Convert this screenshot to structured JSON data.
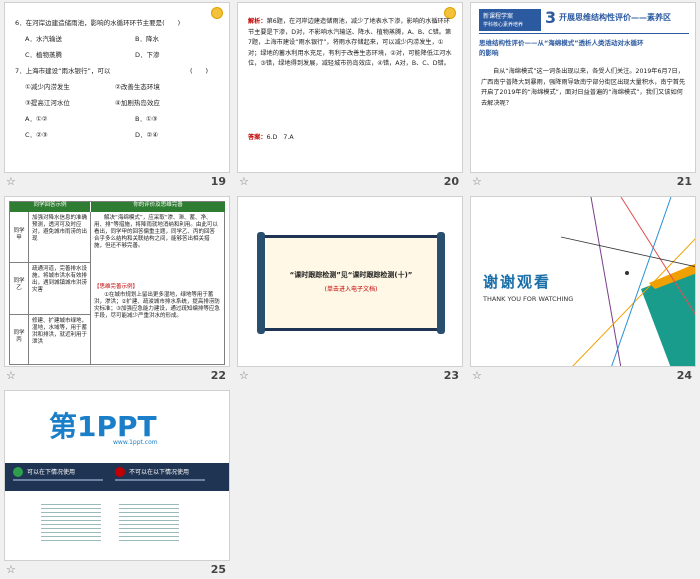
{
  "slides": [
    {
      "number": "19",
      "lines": [
        "6．在河岸边建造储雨池，影响的水循环环节主要是(　　)",
        "A．水汽输送",
        "B．降水",
        "C．植物蒸腾",
        "D．下渗",
        "7．上海市建设“雨水银行”，可以",
        "(　　)",
        "①减少内涝发生",
        "②改善生态环境",
        "③提高江河水位",
        "④加剧热岛效应",
        "A．①②",
        "B．①③",
        "C．②③",
        "D．②④"
      ]
    },
    {
      "number": "20",
      "label": "解析：",
      "text": "第6题，在河岸边建造储雨池，减少了地表水下渗，影响的水循环环节主要是下渗，D对，不影响水汽输送、降水、植物蒸腾，A、B、C错。第7题，上海市建设“雨水银行”，将雨水存储起来，可以减少内涝发生，①对；绿地的蓄水利用水充足，有利于改善生态环境，②对，可能降低江河水位，③错，绿地得到发展，减轻城市热岛效应，④错，A对，B、C、D错。",
      "answer_label": "答案：",
      "answer": "6.D　7.A"
    },
    {
      "number": "21",
      "header_small": "新课程学案",
      "header_sub": "学科核心素养培养",
      "header_num": "3",
      "header_title": "开展思维结构性评价——素养区",
      "subtitle_line1": "思维结构性评价——从“海绵模式”透析人类活动对水循环",
      "subtitle_line2": "的影响",
      "body": "自从“海绵模式”这一词条出现以来，各受人们关注。2019年6月7日，广西南宁普降大到暴雨，强降雨导致南宁部分街区出现大量积水，南宁首先开启了2019年的“海绵模式”，面对日益普遍的“海绵模式”，我们又该如何去解决呢？"
    },
    {
      "number": "22",
      "table_header": [
        "同学回答示例",
        "你的评价及思维完善"
      ],
      "rows": [
        {
          "name": "同学甲",
          "answer": "加强对降水信息的准确预测，透河可及时应对，避免城市雨涝的出现"
        },
        {
          "name": "同学乙",
          "answer": "疏通河道，完善排水设施，将城市洪水有效排出，遇到城镇城市洪涝灾害"
        },
        {
          "name": "同学丙",
          "answer": "修建、扩建城市绿地，湿地，水域等，用于蓄洪和排洪，就近利用于泄洪"
        }
      ],
      "eval1": "解决“海绵模式”，应采取“渗、滞、蓄、净、用、排”等措施，将降雨就地消纳和利用。由此可以看出，同学甲的回答偏重主题，同学乙、丙的回答合乎多么结构和关联结构之间，能够答出相关措施，但还不够完善。",
      "complete_label": "【思维完善示例】",
      "eval2": "①在城市规划上留出更多湿地，绿地等用于蓄洪，渗洪；②扩建、疏浚城市排水系统，提高排涝防灾标准；③加强应急能力建设，通过疏知编排等应急手段，尽可能减少严重洪水的形成。"
    },
    {
      "number": "23",
      "scroll_main": "“课时跟踪检测”见“课时跟踪检测(十)”",
      "scroll_sub": "(单击进入电子文档)"
    },
    {
      "number": "24",
      "thanks_title": "谢谢观看",
      "thanks_sub": "THANK YOU FOR WATCHING"
    },
    {
      "number": "25",
      "logo_main": "第1PPT",
      "logo_url": "www.1ppt.com",
      "can_use": "可以在下情况使用",
      "cannot_use": "不可以在以下情况使用"
    }
  ],
  "colors": {
    "accent_blue": "#1f4e8c",
    "accent_red": "#c00000",
    "teal": "#1a9c8c",
    "orange": "#f0a000",
    "dark_navy": "#1f3352"
  }
}
